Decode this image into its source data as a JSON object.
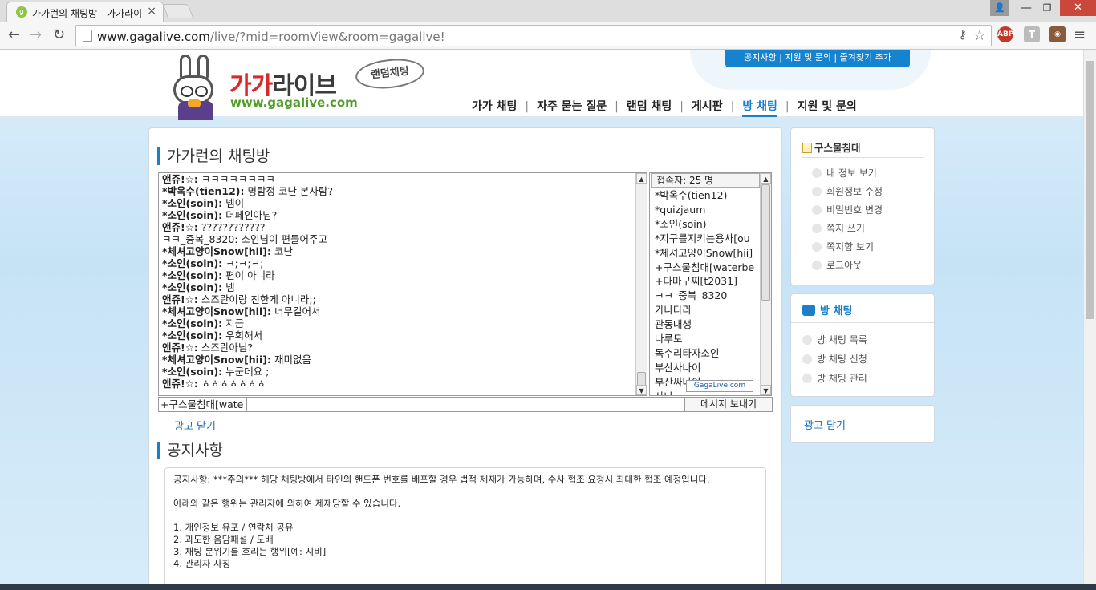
{
  "browser": {
    "tab_title": "가가런의 채팅방 - 가가라이",
    "tab_close": "×",
    "url_host": "www.gagalive.com",
    "url_rest": "/live/?mid=roomView&room=gagalive!",
    "ext_abp": "ABP",
    "ext_t": "T",
    "window_min": "—",
    "window_max": "❐",
    "window_close": "✕"
  },
  "site": {
    "logo_title_red": "가가",
    "logo_title_dark": "라이브",
    "logo_url": "www.gagalive.com",
    "logo_badge": "랜덤채팅",
    "topbar": "공지사항 | 지원 및 문의 | 즐겨찾기 추가",
    "nav": [
      "가가 채팅",
      "자주 묻는 질문",
      "랜덤 채팅",
      "게시판",
      "방 채팅",
      "지원 및 문의"
    ],
    "nav_active": "방 채팅"
  },
  "room": {
    "title": "가가런의 채팅방",
    "chat_lines": [
      {
        "nick": "앤쥬!☆:",
        "msg": " ㅋㅋㅋㅋㅋㅋㅋㅋ"
      },
      {
        "nick": "*박옥수(tien12):",
        "msg": " 명탐정 코난 본사람?"
      },
      {
        "nick": "*소인(soin):",
        "msg": " 넴이"
      },
      {
        "nick": "*소인(soin):",
        "msg": " 더페인아님?"
      },
      {
        "nick": "앤쥬!☆:",
        "msg": " ????????????"
      },
      {
        "nick": "",
        "msg": "ㅋㅋ_중복_8320: 소인님이 편들어주고"
      },
      {
        "nick": "*체셔고양이Snow[hii]:",
        "msg": " 코난"
      },
      {
        "nick": "*소인(soin):",
        "msg": " ㅋ;ㅋ;ㅋ;"
      },
      {
        "nick": "*소인(soin):",
        "msg": " 편이 아니라"
      },
      {
        "nick": "*소인(soin):",
        "msg": " 넴"
      },
      {
        "nick": "앤쥬!☆:",
        "msg": " 스즈란이랑 친한게 아니라;;"
      },
      {
        "nick": "*체셔고양이Snow[hii]:",
        "msg": " 너무길어서"
      },
      {
        "nick": "*소인(soin):",
        "msg": " 지금"
      },
      {
        "nick": "*소인(soin):",
        "msg": " 우회해서"
      },
      {
        "nick": "앤쥬!☆:",
        "msg": " 스즈란아님?"
      },
      {
        "nick": "*체셔고양이Snow[hii]:",
        "msg": " 재미없음"
      },
      {
        "nick": "*소인(soin):",
        "msg": " 누군데요 ;"
      },
      {
        "nick": "앤쥬!☆:",
        "msg": " ㅎㅎㅎㅎㅎㅎㅎ"
      }
    ],
    "user_count_label": "접속자: 25 명",
    "users": [
      "*박옥수(tien12)",
      "*quizjaum",
      "*소인(soin)",
      "*지구를지키는용사[ou",
      "*체셔고양이Snow[hii]",
      "+구스물침대[waterbe",
      "+다마구찌[t2031]",
      "ㅋㅋ_중복_8320",
      "가나다라",
      "관동대생",
      "나루토",
      "독수리타자소인",
      "부산사나이",
      "부산싸나이",
      "사나"
    ],
    "list_logo": "GagaLive.com",
    "nick_value": "+구스물침대[wate",
    "message_value": "",
    "send_label": "메시지 보내기",
    "ad_close": "광고 닫기"
  },
  "notice": {
    "title": "공지사항",
    "lines": [
      "공지사항: ***주의*** 해당 채팅방에서 타인의 핸드폰 번호를 배포할 경우 법적 제재가 가능하며, 수사 협조 요청시 최대한 협조 예정입니다.",
      "",
      "아래와 같은 행위는 관리자에 의하여 제재당할 수 있습니다.",
      "",
      "1. 개인정보 유포 / 연락처 공유",
      "2. 과도한 음담패설 / 도배",
      "3. 채팅 분위기를 흐리는 행위[예: 시비]",
      "4. 관리자 사칭"
    ]
  },
  "sidebar": {
    "profile_header": "구스물침대",
    "profile_links": [
      "내 정보 보기",
      "회원정보 수정",
      "비밀번호 변경",
      "쪽지 쓰기",
      "쪽지함 보기",
      "로그아웃"
    ],
    "room_header": "방 채팅",
    "room_links": [
      "방 채팅 목록",
      "방 채팅 신청",
      "방 채팅 관리"
    ],
    "ad_close": "광고 닫기"
  }
}
